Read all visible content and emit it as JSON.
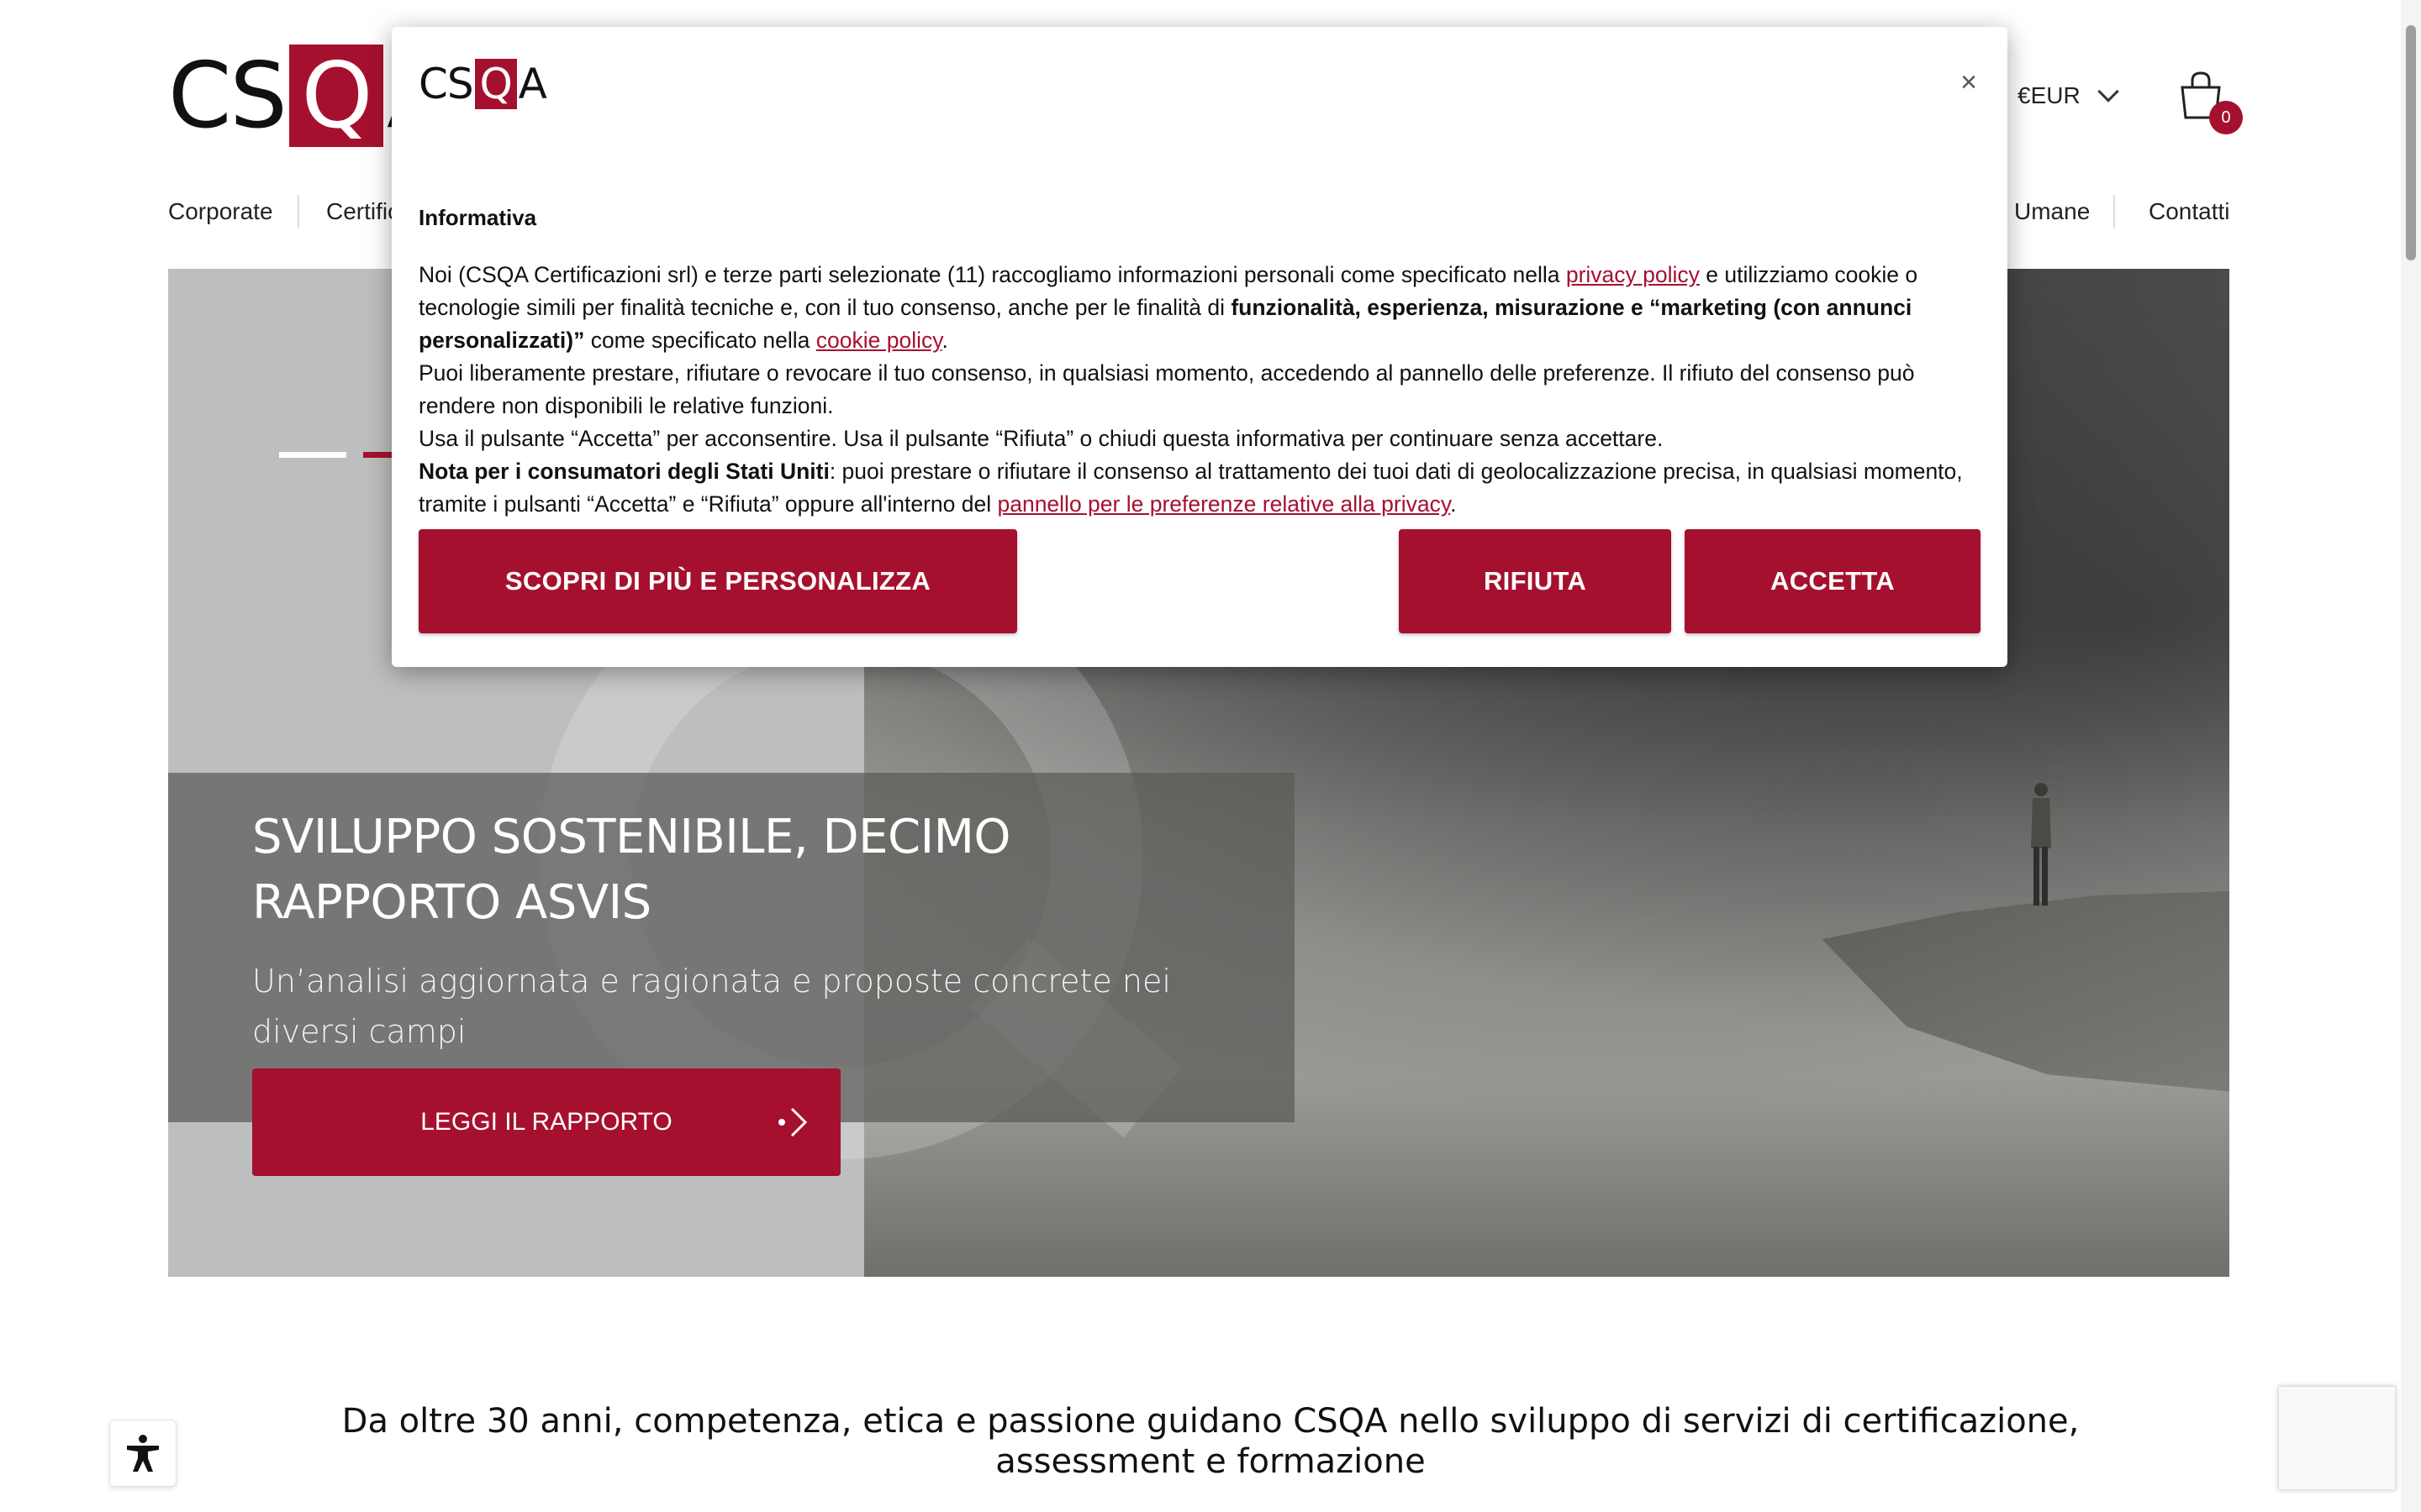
{
  "header": {
    "logo_text": [
      "CS",
      "Q",
      "A"
    ],
    "currency": "€EUR",
    "cart_count": "0"
  },
  "nav": {
    "items": [
      "Corporate",
      "Certific",
      "Umane",
      "Contatti"
    ]
  },
  "hero": {
    "slide_index": 2,
    "slide_total": 4,
    "title": "SVILUPPO SOSTENIBILE, DECIMO RAPPORTO ASVIS",
    "subtitle": "Un’analisi aggiornata e ragionata e proposte concrete nei diversi campi",
    "button_label": "LEGGI IL RAPPORTO"
  },
  "tagline": "Da oltre 30 anni, competenza, etica e passione guidano CSQA nello sviluppo di servizi di certificazione, assessment e formazione",
  "cookie_banner": {
    "logo_text": [
      "CS",
      "Q",
      "A"
    ],
    "close_label": "×",
    "heading": "Informativa",
    "p1_a": "Noi (CSQA Certificazioni srl) e terze parti selezionate (11) raccogliamo informazioni personali come specificato nella ",
    "p1_link1": "privacy policy",
    "p1_b": " e utilizziamo cookie o tecnologie simili per finalità tecniche e, con il tuo consenso, anche per le finalità di ",
    "p1_bold": "funzionalità, esperienza, misurazione e “marketing (con annunci personalizzati)”",
    "p1_c": " come specificato nella ",
    "p1_link2": "cookie policy",
    "p1_d": ".",
    "p2": "Puoi liberamente prestare, rifiutare o revocare il tuo consenso, in qualsiasi momento, accedendo al pannello delle preferenze. Il rifiuto del consenso può rendere non disponibili le relative funzioni.",
    "p3": "Usa il pulsante “Accetta” per acconsentire. Usa il pulsante “Rifiuta” o chiudi questa informativa per continuare senza accettare.",
    "p4_bold": "Nota per i consumatori degli Stati Uniti",
    "p4_a": ": puoi prestare o rifiutare il consenso al trattamento dei tuoi dati di geolocalizzazione precisa, in qualsiasi momento, tramite i pulsanti “Accetta” e “Rifiuta” oppure all'interno del ",
    "p4_link": "pannello per le preferenze relative alla privacy",
    "p4_b": ".",
    "btn_customize": "SCOPRI DI PIÙ E PERSONALIZZA",
    "btn_reject": "RIFIUTA",
    "btn_accept": "ACCETTA"
  },
  "colors": {
    "brand": "#a6102f"
  }
}
